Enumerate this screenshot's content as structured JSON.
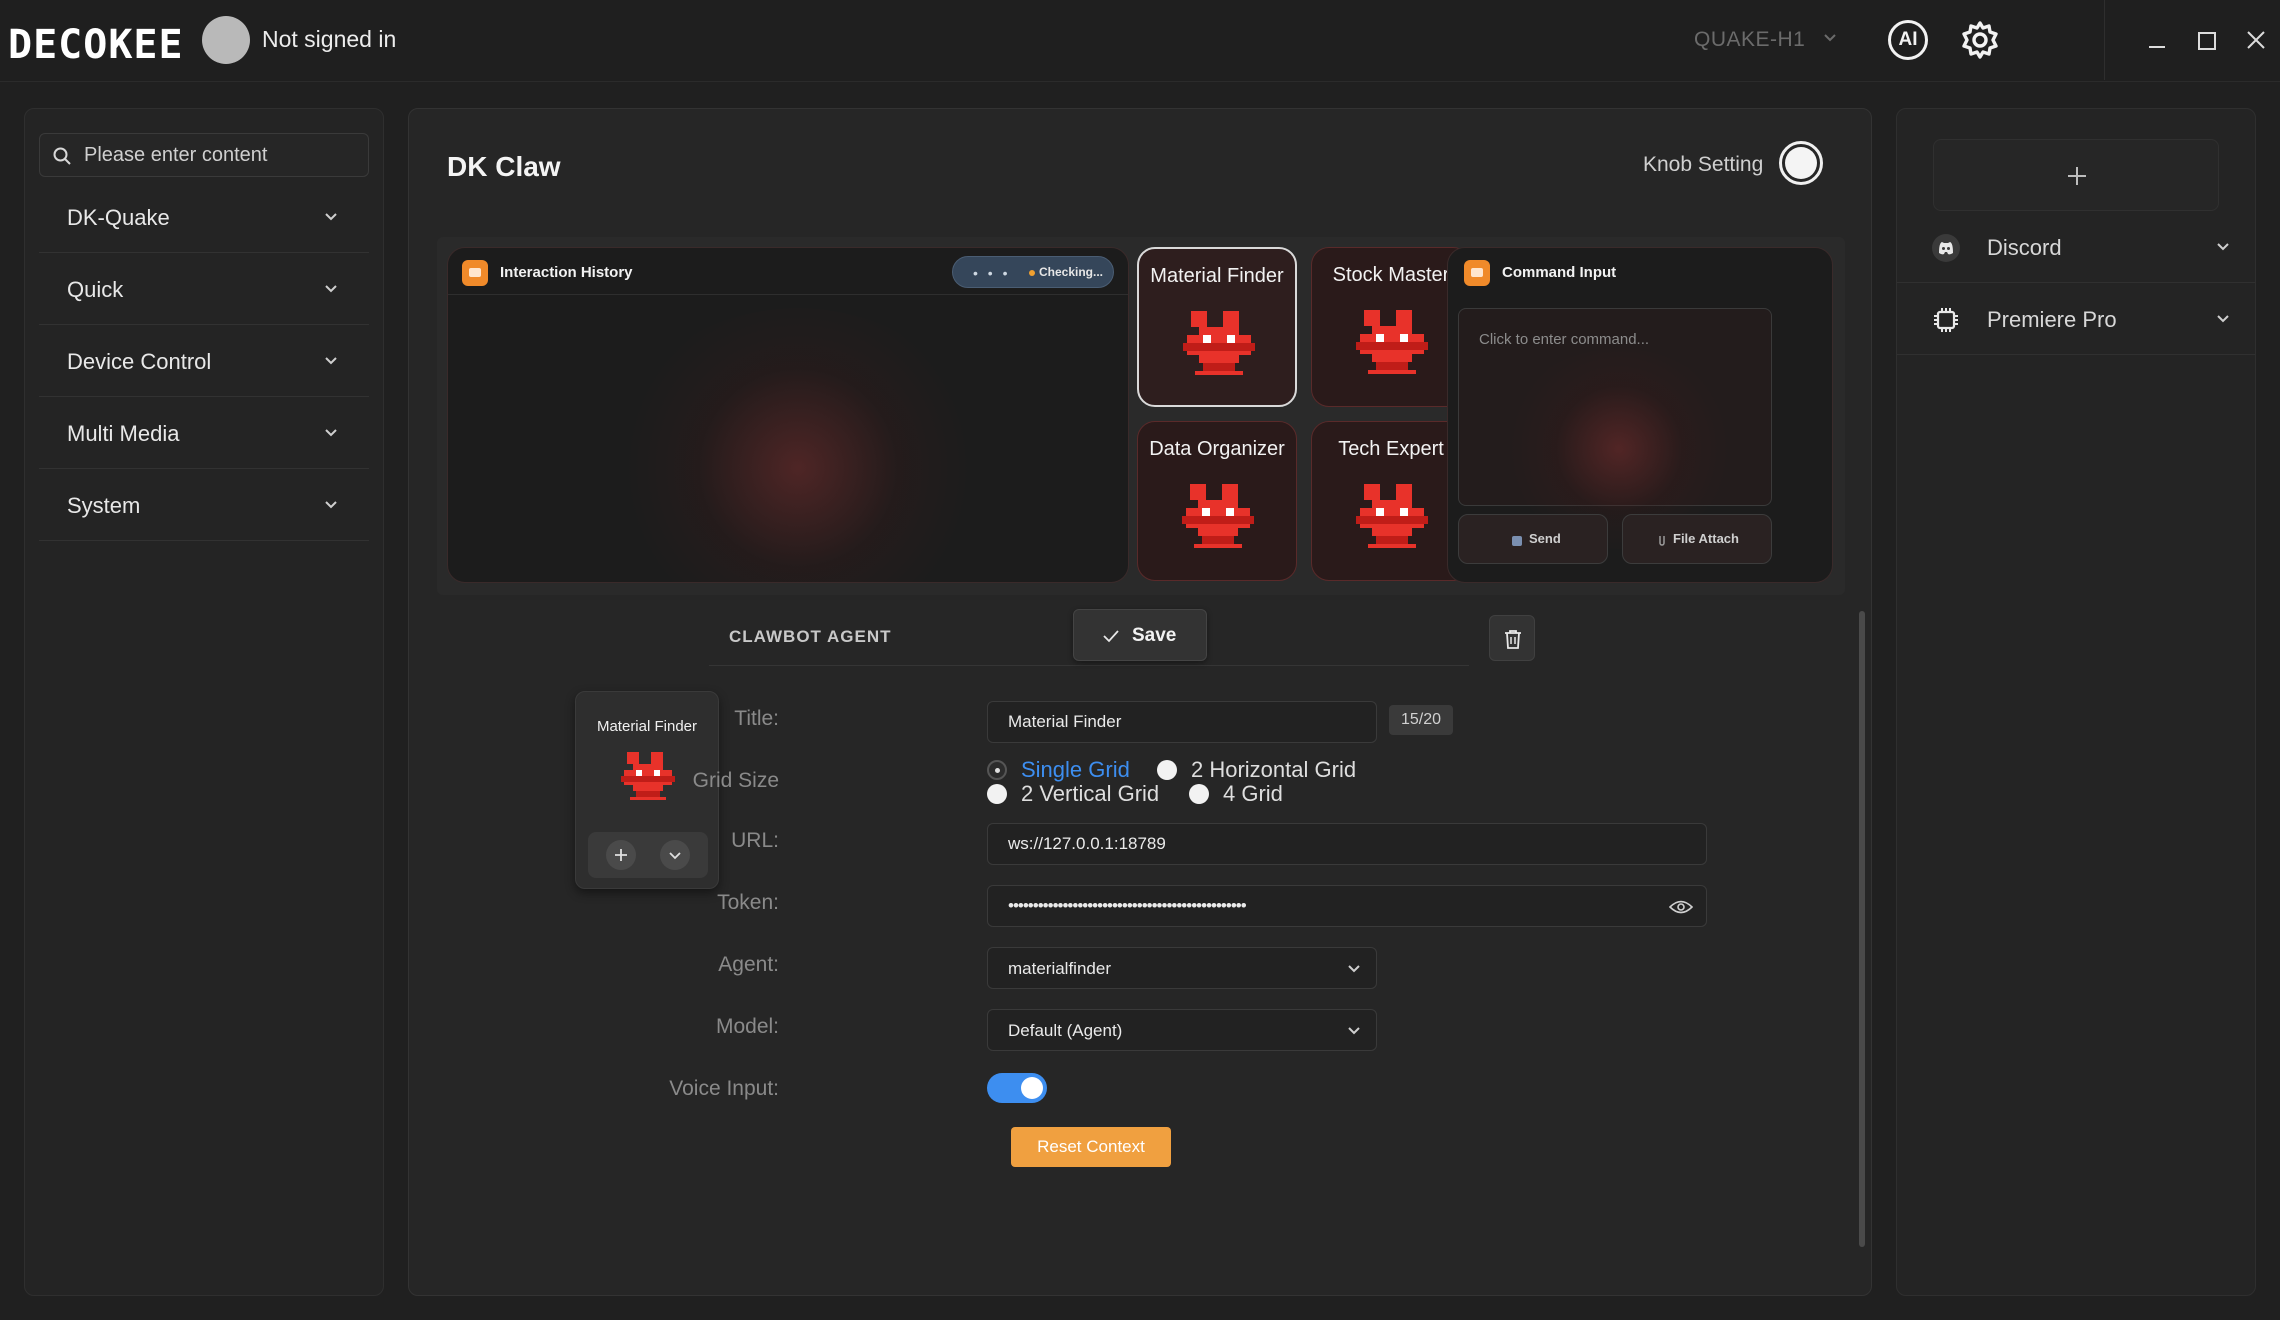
{
  "app": {
    "logo": "DECOKEE",
    "user_status": "Not signed in",
    "device": "QUAKE-H1",
    "ai_label": "AI"
  },
  "sidebar": {
    "search_placeholder": "Please enter content",
    "items": [
      {
        "label": "DK-Quake"
      },
      {
        "label": "Quick"
      },
      {
        "label": "Device Control"
      },
      {
        "label": "Multi Media"
      },
      {
        "label": "System"
      }
    ]
  },
  "main": {
    "title": "DK Claw",
    "knob_setting_label": "Knob Setting",
    "history": {
      "label": "Interaction History",
      "status_dots": "• • •",
      "status_text": "Checking..."
    },
    "agents": [
      {
        "name": "Material Finder",
        "selected": true
      },
      {
        "name": "Stock Master",
        "selected": false
      },
      {
        "name": "Data Organizer",
        "selected": false
      },
      {
        "name": "Tech Expert",
        "selected": false
      }
    ],
    "command": {
      "label": "Command Input",
      "placeholder": "Click to enter command...",
      "send_label": "Send",
      "file_label": "File Attach"
    }
  },
  "agent_settings": {
    "section_label": "CLAWBOT AGENT",
    "save_label": "Save",
    "preview_name": "Material Finder",
    "fields": {
      "title_label": "Title:",
      "title_value": "Material Finder",
      "title_count": "15/20",
      "grid_label": "Grid Size",
      "grid_options": [
        "Single Grid",
        "2 Horizontal Grid",
        "2 Vertical Grid",
        "4 Grid"
      ],
      "grid_selected": "Single Grid",
      "url_label": "URL:",
      "url_value": "ws://127.0.0.1:18789",
      "token_label": "Token:",
      "token_value": "••••••••••••••••••••••••••••••••••••••••••••••••",
      "agent_label": "Agent:",
      "agent_value": "materialfinder",
      "model_label": "Model:",
      "model_value": "Default (Agent)",
      "voice_label": "Voice Input:",
      "voice_enabled": true,
      "reset_label": "Reset Context"
    }
  },
  "right_panel": {
    "plugins": [
      {
        "label": "Discord",
        "icon": "discord-icon"
      },
      {
        "label": "Premiere Pro",
        "icon": "chip-icon"
      }
    ]
  },
  "colors": {
    "accent_blue": "#3d8ef0",
    "reset_orange": "#f0a040",
    "card_icon_orange": "#f08a2a",
    "bot_red": "#e8322a"
  }
}
